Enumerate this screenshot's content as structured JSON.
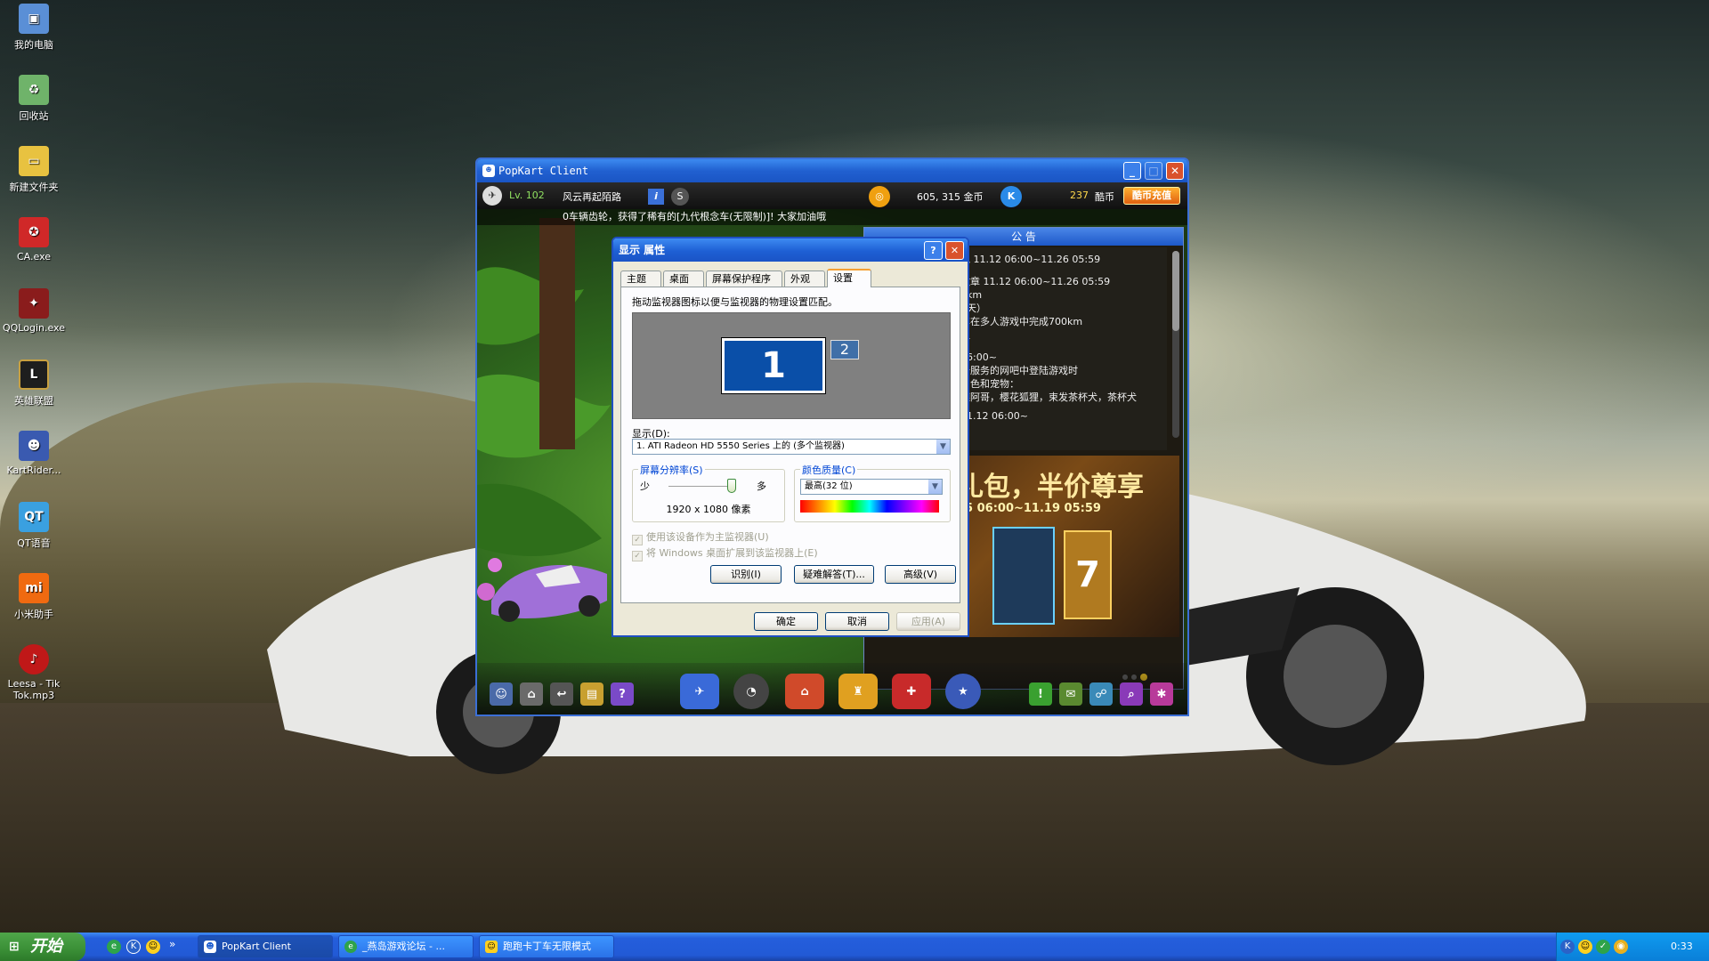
{
  "desktop_icons": [
    {
      "label": "我的电脑",
      "icon": "computer-icon"
    },
    {
      "label": "回收站",
      "icon": "recycle-bin-icon"
    },
    {
      "label": "新建文件夹",
      "icon": "folder-icon"
    },
    {
      "label": "CA.exe",
      "icon": "ca-app-icon"
    },
    {
      "label": "QQLogin.exe",
      "icon": "qqlogin-app-icon"
    },
    {
      "label": "英雄联盟",
      "icon": "lol-app-icon"
    },
    {
      "label": "KartRider...",
      "icon": "kartrider-app-icon"
    },
    {
      "label": "QT语音",
      "icon": "qt-voice-icon"
    },
    {
      "label": "小米助手",
      "icon": "mi-assistant-icon"
    },
    {
      "label": "Leesa - Tik Tok.mp3",
      "icon": "mp3-file-icon"
    }
  ],
  "game_window": {
    "title": "PopKart Client",
    "level": "Lv. 102",
    "player_name": "风云再起陌路",
    "gold": "605, 315 金币",
    "kcoins": "237",
    "kcoins_unit": "酷币",
    "recharge_label": "酷币充值",
    "ticker": "0车辆齿轮，获得了稀有的[九代根念车(无限制)]! 大家加油哦",
    "notice_title": "公 告",
    "notice_lines": [
      "包  11.12 06:00~11.26 05:59",
      "徽章  11.12 06:00~11.26 05:59",
      "0km",
      "7天）",
      "车在多人游戏中完成700km",
      "显",
      "06:00~",
      "于服务的网吧中登陆游戏时",
      "角色和宠物：",
      "德阿哥，樱花狐狸，束发茶杯犬，茶杯犬",
      "11.12 06:00~"
    ],
    "banner_headline": "礼包，半价尊享",
    "banner_dates": "05 06:00~11.19 05:59"
  },
  "dialog": {
    "title": "显示 属性",
    "help_label": "?",
    "close_label": "✕",
    "tabs": [
      "主题",
      "桌面",
      "屏幕保护程序",
      "外观",
      "设置"
    ],
    "active_tab": "设置",
    "instruction": "拖动监视器图标以便与监视器的物理设置匹配。",
    "monitor1_label": "1",
    "monitor2_label": "2",
    "display_label": "显示(D):",
    "display_value": "1. ATI Radeon HD 5550 Series 上的 (多个监视器)",
    "resolution_group": "屏幕分辨率(S)",
    "res_less": "少",
    "res_more": "多",
    "resolution_value": "1920 x 1080 像素",
    "color_group": "颜色质量(C)",
    "color_value": "最高(32 位)",
    "primary_checkbox": "使用该设备作为主监视器(U)",
    "extend_checkbox": "将 Windows 桌面扩展到该监视器上(E)",
    "identify_label": "识别(I)",
    "troubleshoot_label": "疑难解答(T)...",
    "advanced_label": "高级(V)",
    "ok_label": "确定",
    "cancel_label": "取消",
    "apply_label": "应用(A)"
  },
  "taskbar": {
    "start_label": "开始",
    "chevron": "»",
    "tasks": [
      "PopKart Client",
      "_燕岛游戏论坛 - ...",
      "跑跑卡丁车无限模式"
    ],
    "clock": "0:33"
  }
}
